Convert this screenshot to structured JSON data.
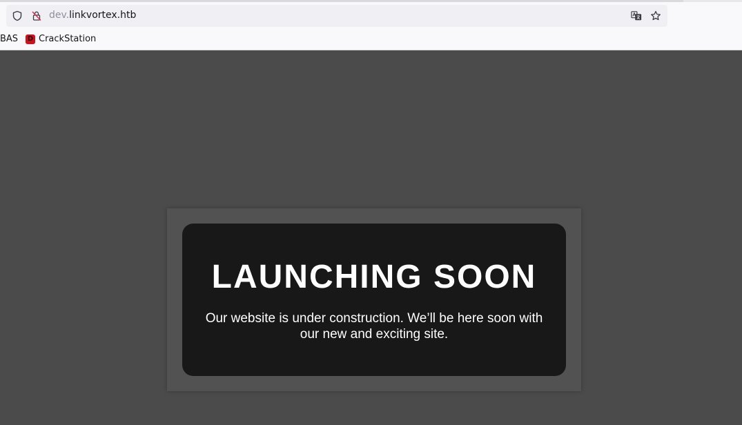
{
  "browser": {
    "url_subdomain": "dev.",
    "url_domain": "linkvortex.htb",
    "icons": {
      "shield": "shield-icon",
      "insecure": "insecure-connection-icon",
      "translate": "translate-icon",
      "bookmark_star": "bookmark-star-icon"
    }
  },
  "bookmarks": {
    "items": [
      {
        "label": "BAS"
      },
      {
        "label": "CrackStation",
        "favicon_letter": "D"
      }
    ]
  },
  "page": {
    "headline": "LAUNCHING SOON",
    "message": "Our website is under construction. We’ll be here soon with our new and exciting site.",
    "colors": {
      "background": "#4b4b4b",
      "card_outer": "#525252",
      "card_inner": "#181818",
      "text": "#ffffff"
    }
  }
}
